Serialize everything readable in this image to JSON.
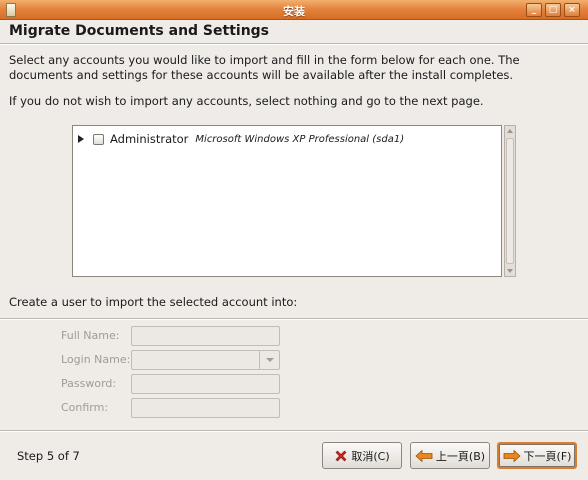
{
  "window": {
    "title": "安装",
    "min_label": "_",
    "max_label": "□",
    "close_label": "×"
  },
  "page": {
    "heading": "Migrate Documents and Settings",
    "intro_line1": "Select any accounts you would like to import and fill in the form below for each one.  The",
    "intro_line2": "documents and settings for these accounts will be available after the install completes.",
    "intro_line3": "If you do not wish to import any accounts, select nothing and go to the next page."
  },
  "accounts": [
    {
      "name": "Administrator",
      "os": "Microsoft Windows XP Professional (sda1)",
      "checked": false,
      "expanded": false
    }
  ],
  "form": {
    "caption": "Create a user to import the selected account into:",
    "full_name_label": "Full Name:",
    "login_name_label": "Login Name:",
    "password_label": "Password:",
    "confirm_label": "Confirm:",
    "full_name_value": "",
    "login_name_value": "",
    "password_value": "",
    "confirm_value": ""
  },
  "footer": {
    "step_text": "Step 5 of 7",
    "cancel_label": "取消(C)",
    "back_label": "上一頁(B)",
    "forward_label": "下一頁(F)"
  },
  "colors": {
    "titlebar_accent": "#e4853f",
    "cancel_icon": "#cc2a1e",
    "arrow_icon": "#e8881c"
  }
}
